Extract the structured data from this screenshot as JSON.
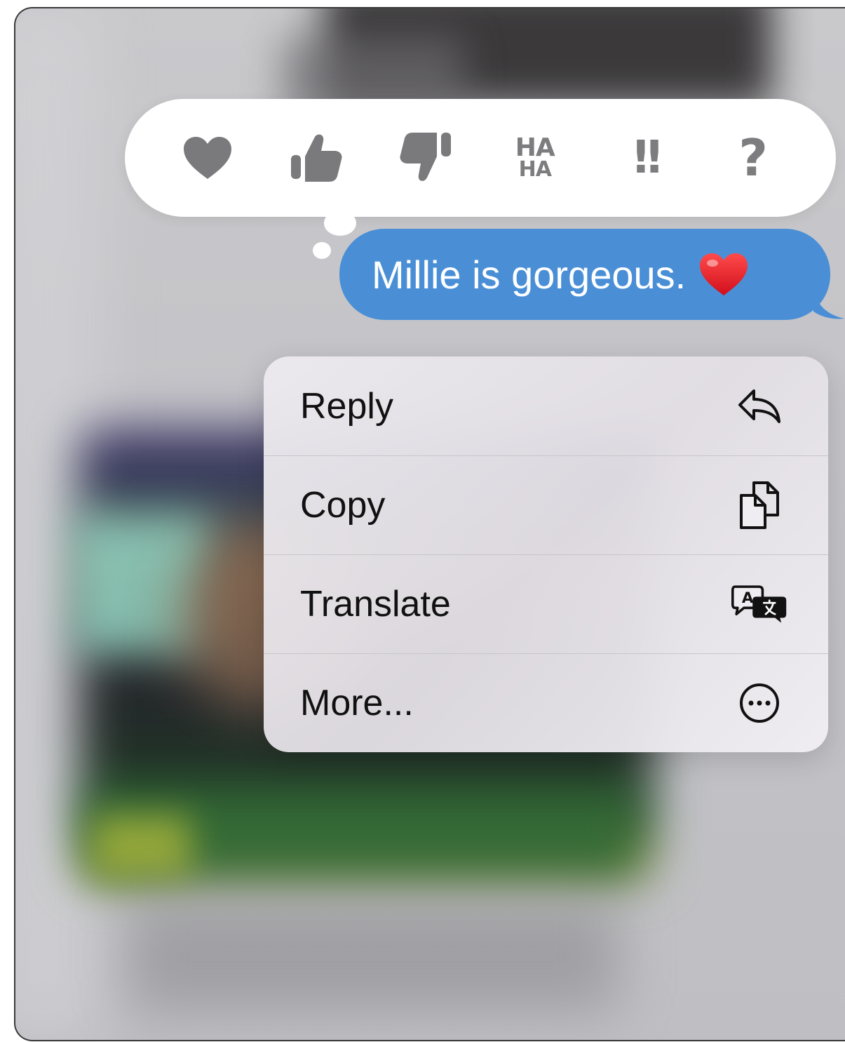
{
  "tapbacks": [
    {
      "name": "heart-icon",
      "label": "Heart"
    },
    {
      "name": "thumbs-up-icon",
      "label": "Like"
    },
    {
      "name": "thumbs-down-icon",
      "label": "Dislike"
    },
    {
      "name": "haha-icon",
      "label": "HA HA"
    },
    {
      "name": "exclamation-icon",
      "label": "!!"
    },
    {
      "name": "question-icon",
      "label": "?"
    }
  ],
  "haha": {
    "line1": "HA",
    "line2": "HA"
  },
  "exclaim": {
    "text": "!!"
  },
  "question": {
    "text": "?"
  },
  "message": {
    "text": "Millie is gorgeous.",
    "emoji": "red-heart-emoji",
    "bubble_color": "#4a8fd6"
  },
  "menu": {
    "items": [
      {
        "label": "Reply",
        "icon": "reply-icon"
      },
      {
        "label": "Copy",
        "icon": "copy-icon"
      },
      {
        "label": "Translate",
        "icon": "translate-icon"
      },
      {
        "label": "More...",
        "icon": "more-icon"
      }
    ]
  }
}
